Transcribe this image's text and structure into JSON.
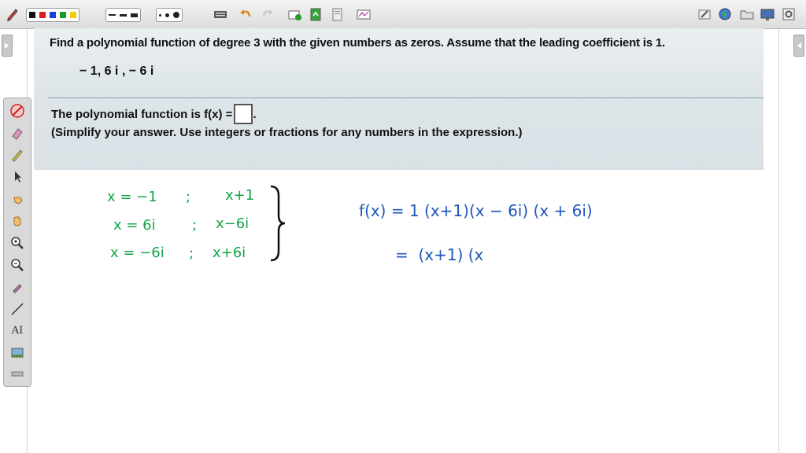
{
  "problem": {
    "question": "Find a polynomial function of degree 3 with the given numbers as zeros. Assume that the leading coefficient is 1.",
    "zeros": "− 1, 6 i , − 6 i",
    "answer_prefix": "The polynomial function is f(x) =",
    "answer_suffix": ".",
    "instruction": "(Simplify your answer. Use integers or fractions for any numbers in the expression.)"
  },
  "notes": {
    "left_column": [
      {
        "zero": "x = −1",
        "sep": ";",
        "factor": "x+1"
      },
      {
        "zero": "x = 6i",
        "sep": ";",
        "factor": "x−6i"
      },
      {
        "zero": "x = −6i",
        "sep": ";",
        "factor": "x+6i"
      }
    ],
    "right_line1": "f(x) = 1 (x+1)(x − 6i) (x + 6i)",
    "right_line2": "=  (x+1) (x"
  },
  "colors": {
    "green_ink": "#16a34a",
    "blue_ink": "#1f57b8",
    "problem_bg": "#e3e9ed"
  },
  "toolbar": {
    "icons": [
      "pen-icon",
      "color-swatches",
      "line-style",
      "dot-size",
      "keyboard-icon",
      "undo-icon",
      "redo-icon",
      "new-page-icon",
      "insert-page-icon",
      "page-icon",
      "screen-icon",
      "edit-icon",
      "globe-icon",
      "folder-icon",
      "monitor-icon",
      "settings-icon"
    ]
  }
}
